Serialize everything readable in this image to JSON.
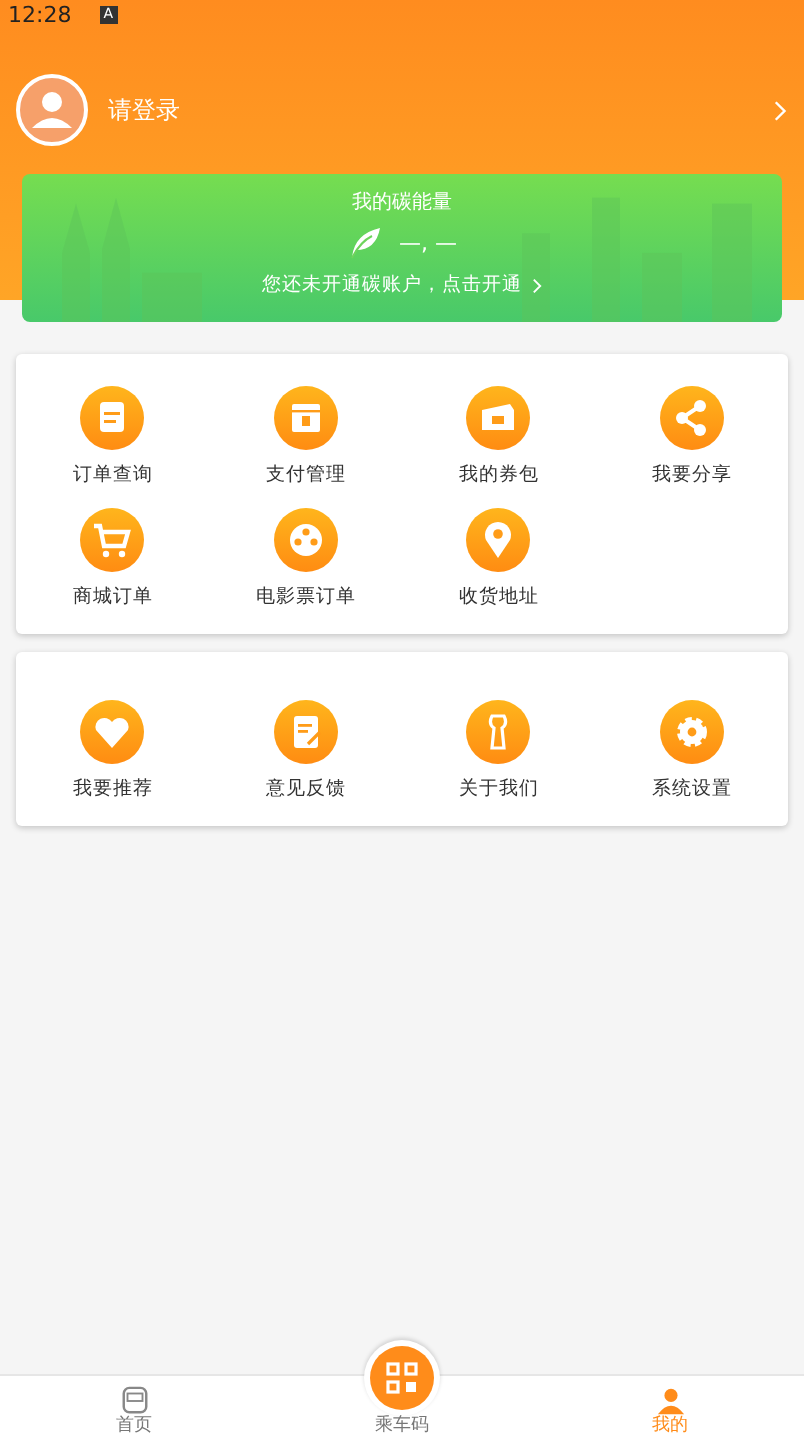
{
  "status_bar": {
    "time": "12:28",
    "badge": "A"
  },
  "profile": {
    "login_label": "请登录"
  },
  "carbon_card": {
    "title": "我的碳能量",
    "value": "—, —",
    "link": "您还未开通碳账户，点击开通"
  },
  "menu_groups": [
    {
      "items": [
        {
          "label": "订单查询"
        },
        {
          "label": "支付管理"
        },
        {
          "label": "我的券包"
        },
        {
          "label": "我要分享"
        },
        {
          "label": "商城订单"
        },
        {
          "label": "电影票订单"
        },
        {
          "label": "收货地址"
        }
      ]
    },
    {
      "items": [
        {
          "label": "我要推荐"
        },
        {
          "label": "意见反馈"
        },
        {
          "label": "关于我们"
        },
        {
          "label": "系统设置"
        }
      ]
    }
  ],
  "bottom_nav": [
    {
      "label": "首页",
      "kind": "home",
      "selected": false
    },
    {
      "label": "乘车码",
      "kind": "qr",
      "selected": false
    },
    {
      "label": "我的",
      "kind": "me",
      "selected": true
    }
  ]
}
